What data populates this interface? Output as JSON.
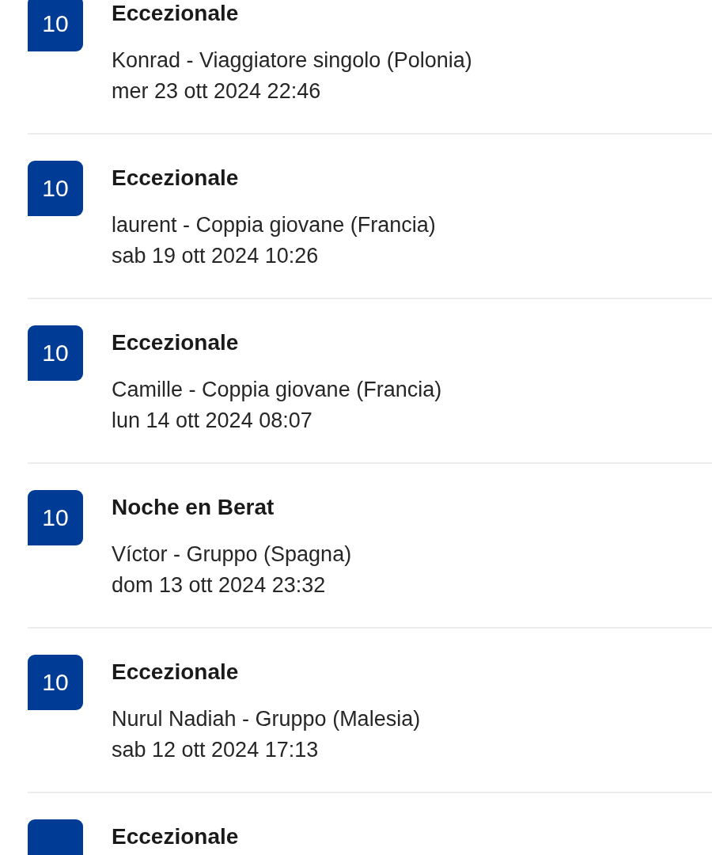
{
  "reviews": [
    {
      "score": "10",
      "title": "Eccezionale",
      "reviewer": "Konrad - Viaggiatore singolo (Polonia)",
      "date": "mer 23 ott 2024 22:46"
    },
    {
      "score": "10",
      "title": "Eccezionale",
      "reviewer": "laurent - Coppia giovane (Francia)",
      "date": "sab 19 ott 2024 10:26"
    },
    {
      "score": "10",
      "title": "Eccezionale",
      "reviewer": "Camille - Coppia giovane (Francia)",
      "date": "lun 14 ott 2024 08:07"
    },
    {
      "score": "10",
      "title": "Noche en Berat",
      "reviewer": "Víctor - Gruppo (Spagna)",
      "date": "dom 13 ott 2024 23:32"
    },
    {
      "score": "10",
      "title": "Eccezionale",
      "reviewer": "Nurul Nadiah - Gruppo (Malesia)",
      "date": "sab 12 ott 2024 17:13"
    },
    {
      "title": "Eccezionale"
    }
  ]
}
